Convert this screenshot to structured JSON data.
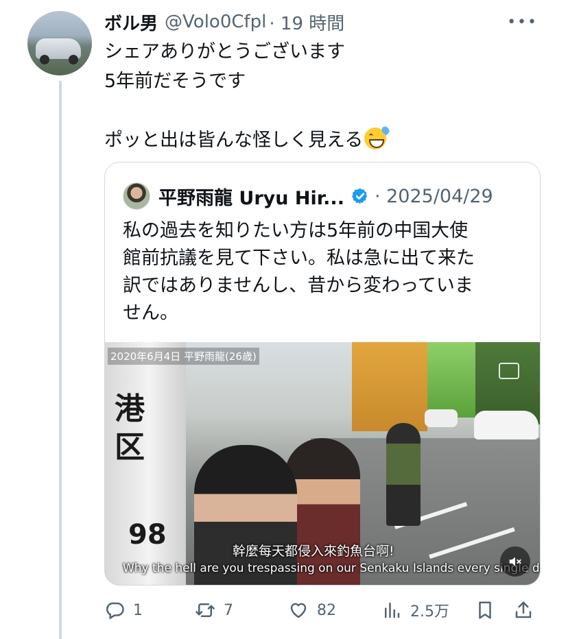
{
  "tweet": {
    "author_name": "ボル男",
    "author_handle": "@Volo0Cfpl",
    "time": "· 19 時間",
    "more_glyph": "•••",
    "text_lines": [
      "シェアありがとうございます",
      "5年前だそうです",
      "",
      "ポッと出は皆んな怪しく見える"
    ],
    "emoji": "sweat-smile-emoji"
  },
  "quote": {
    "author_name": "平野雨龍 Uryu Hir...",
    "date": "· 2025/04/29",
    "verified": true,
    "text_lines": [
      "私の過去を知りたい方は5年前の中国大使",
      "館前抗議を見て下さい。私は急に出て来た",
      "訳ではありませんし、昔から変わっていま",
      "せん。"
    ],
    "video": {
      "caption_top": "2020年6月4日 平野雨龍(26歳)",
      "pole_chars": [
        "港",
        "区"
      ],
      "pole_number": "98",
      "subtitle_jp": "幹麼每天都侵入來釣魚台啊!",
      "subtitle_en": "Why the hell are you trespassing on our Senkaku Islands every single day?"
    }
  },
  "actions": {
    "replies": "1",
    "reposts": "7",
    "likes": "82",
    "views": "2.5万"
  },
  "colors": {
    "text": "#0f1419",
    "secondary": "#536471",
    "border": "#cfd9de",
    "verified": "#1d9bf0"
  }
}
